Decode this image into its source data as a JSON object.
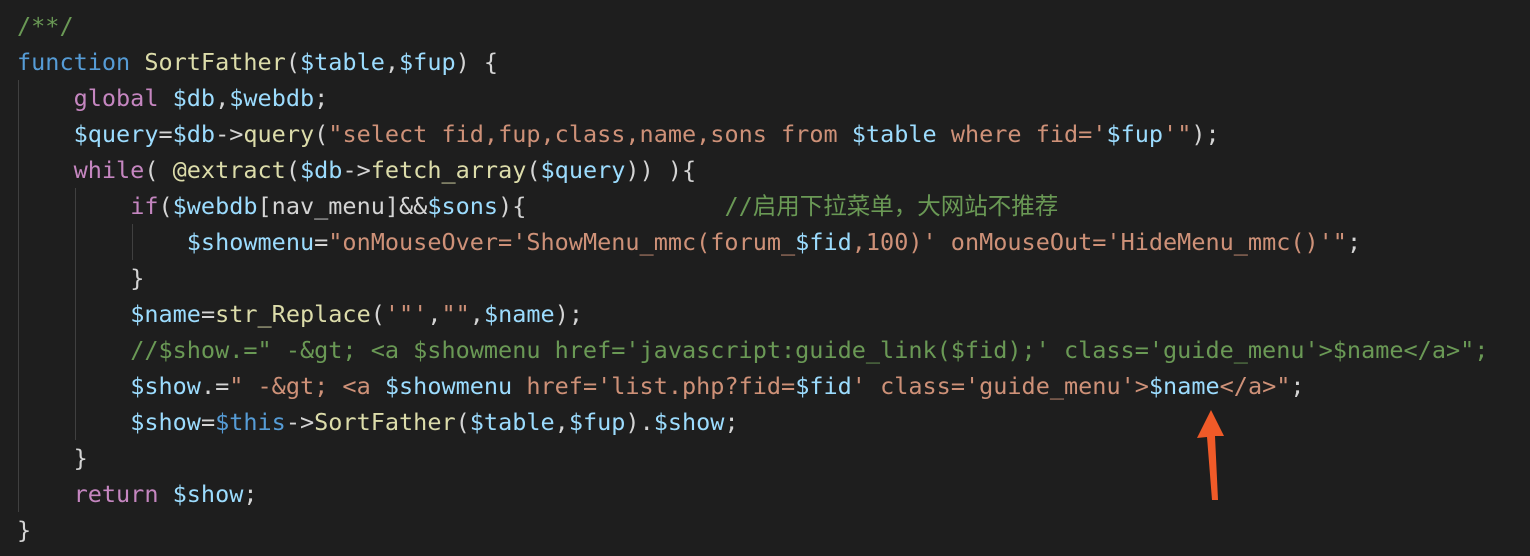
{
  "editor": {
    "theme_colors": {
      "background": "#1e1e1e",
      "comment": "#6a9955",
      "keyword": "#569cd6",
      "control": "#c586c0",
      "function": "#dcdcaa",
      "variable": "#9cdcfe",
      "string": "#ce9178",
      "number": "#b5cea8",
      "punctuation": "#d4d4d4",
      "annotation_arrow": "#f05a28"
    },
    "lines": [
      {
        "indent": "",
        "tokens": [
          {
            "t": "comment",
            "v": "/**/"
          }
        ]
      },
      {
        "indent": "",
        "tokens": [
          {
            "t": "keyword",
            "v": "function"
          },
          {
            "t": "punct",
            "v": " "
          },
          {
            "t": "func",
            "v": "SortFather"
          },
          {
            "t": "punct",
            "v": "("
          },
          {
            "t": "var",
            "v": "$table"
          },
          {
            "t": "punct",
            "v": ","
          },
          {
            "t": "var",
            "v": "$fup"
          },
          {
            "t": "punct",
            "v": ") {"
          }
        ]
      },
      {
        "indent": "    ",
        "tokens": [
          {
            "t": "control",
            "v": "global"
          },
          {
            "t": "punct",
            "v": " "
          },
          {
            "t": "var",
            "v": "$db"
          },
          {
            "t": "punct",
            "v": ","
          },
          {
            "t": "var",
            "v": "$webdb"
          },
          {
            "t": "punct",
            "v": ";"
          }
        ]
      },
      {
        "indent": "    ",
        "tokens": [
          {
            "t": "var",
            "v": "$query"
          },
          {
            "t": "punct",
            "v": "="
          },
          {
            "t": "var",
            "v": "$db"
          },
          {
            "t": "punct",
            "v": "->"
          },
          {
            "t": "func",
            "v": "query"
          },
          {
            "t": "punct",
            "v": "("
          },
          {
            "t": "string",
            "v": "\"select fid,fup,class,name,sons from "
          },
          {
            "t": "var",
            "v": "$table"
          },
          {
            "t": "string",
            "v": " where fid='"
          },
          {
            "t": "var",
            "v": "$fup"
          },
          {
            "t": "string",
            "v": "'\""
          },
          {
            "t": "punct",
            "v": ");"
          }
        ]
      },
      {
        "indent": "    ",
        "tokens": [
          {
            "t": "control",
            "v": "while"
          },
          {
            "t": "punct",
            "v": "( "
          },
          {
            "t": "func",
            "v": "@extract"
          },
          {
            "t": "punct",
            "v": "("
          },
          {
            "t": "var",
            "v": "$db"
          },
          {
            "t": "punct",
            "v": "->"
          },
          {
            "t": "func",
            "v": "fetch_array"
          },
          {
            "t": "punct",
            "v": "("
          },
          {
            "t": "var",
            "v": "$query"
          },
          {
            "t": "punct",
            "v": ")) ){"
          }
        ]
      },
      {
        "indent": "        ",
        "tokens": [
          {
            "t": "control",
            "v": "if"
          },
          {
            "t": "punct",
            "v": "("
          },
          {
            "t": "var",
            "v": "$webdb"
          },
          {
            "t": "punct",
            "v": "[nav_menu]&&"
          },
          {
            "t": "var",
            "v": "$sons"
          },
          {
            "t": "punct",
            "v": "){              "
          },
          {
            "t": "comment",
            "v": "//启用下拉菜单，大网站不推荐"
          }
        ]
      },
      {
        "indent": "            ",
        "tokens": [
          {
            "t": "var",
            "v": "$showmenu"
          },
          {
            "t": "punct",
            "v": "="
          },
          {
            "t": "string",
            "v": "\"onMouseOver='ShowMenu_mmc(forum_"
          },
          {
            "t": "var",
            "v": "$fid"
          },
          {
            "t": "string",
            "v": ",100)' onMouseOut='HideMenu_mmc()'\""
          },
          {
            "t": "punct",
            "v": ";"
          }
        ]
      },
      {
        "indent": "        ",
        "tokens": [
          {
            "t": "punct",
            "v": "}"
          }
        ]
      },
      {
        "indent": "        ",
        "tokens": [
          {
            "t": "var",
            "v": "$name"
          },
          {
            "t": "punct",
            "v": "="
          },
          {
            "t": "func",
            "v": "str_Replace"
          },
          {
            "t": "punct",
            "v": "("
          },
          {
            "t": "string",
            "v": "'\"'"
          },
          {
            "t": "punct",
            "v": ","
          },
          {
            "t": "string",
            "v": "\"\""
          },
          {
            "t": "punct",
            "v": ","
          },
          {
            "t": "var",
            "v": "$name"
          },
          {
            "t": "punct",
            "v": ");"
          }
        ]
      },
      {
        "indent": "        ",
        "tokens": [
          {
            "t": "comment",
            "v": "//$show.=\" -&gt; <a $showmenu href='javascript:guide_link($fid);' class='guide_menu'>$name</a>\";"
          }
        ]
      },
      {
        "indent": "        ",
        "tokens": [
          {
            "t": "var",
            "v": "$show"
          },
          {
            "t": "punct",
            "v": ".="
          },
          {
            "t": "string",
            "v": "\" -&gt; <a "
          },
          {
            "t": "var",
            "v": "$showmenu"
          },
          {
            "t": "string",
            "v": " href='list.php?fid="
          },
          {
            "t": "var",
            "v": "$fid"
          },
          {
            "t": "string",
            "v": "' class='guide_menu'>"
          },
          {
            "t": "var",
            "v": "$name"
          },
          {
            "t": "string",
            "v": "</a>\""
          },
          {
            "t": "punct",
            "v": ";"
          }
        ]
      },
      {
        "indent": "        ",
        "tokens": [
          {
            "t": "var",
            "v": "$show"
          },
          {
            "t": "punct",
            "v": "="
          },
          {
            "t": "keyword",
            "v": "$this"
          },
          {
            "t": "punct",
            "v": "->"
          },
          {
            "t": "func",
            "v": "SortFather"
          },
          {
            "t": "punct",
            "v": "("
          },
          {
            "t": "var",
            "v": "$table"
          },
          {
            "t": "punct",
            "v": ","
          },
          {
            "t": "var",
            "v": "$fup"
          },
          {
            "t": "punct",
            "v": ")."
          },
          {
            "t": "var",
            "v": "$show"
          },
          {
            "t": "punct",
            "v": ";"
          }
        ]
      },
      {
        "indent": "    ",
        "tokens": [
          {
            "t": "punct",
            "v": "}"
          }
        ]
      },
      {
        "indent": "    ",
        "tokens": [
          {
            "t": "control",
            "v": "return"
          },
          {
            "t": "punct",
            "v": " "
          },
          {
            "t": "var",
            "v": "$show"
          },
          {
            "t": "punct",
            "v": ";"
          }
        ]
      },
      {
        "indent": "",
        "tokens": [
          {
            "t": "punct",
            "v": "}"
          }
        ]
      }
    ],
    "annotation": {
      "icon": "up-arrow-icon"
    }
  }
}
